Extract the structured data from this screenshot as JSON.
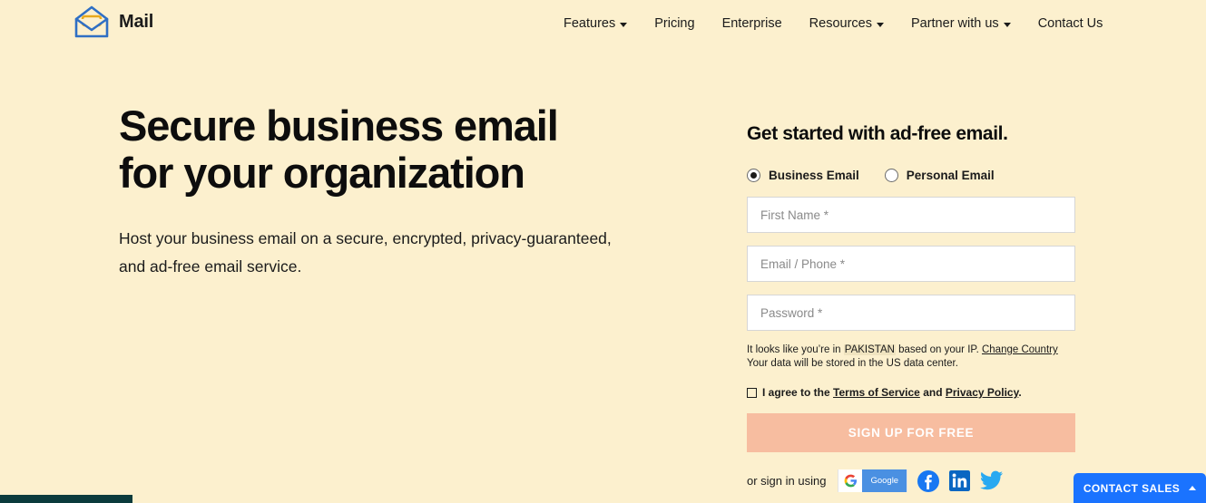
{
  "brand": {
    "name": "Mail",
    "logo_icon": "open-envelope-icon"
  },
  "nav": {
    "items": [
      {
        "label": "Features",
        "has_dropdown": true
      },
      {
        "label": "Pricing",
        "has_dropdown": false
      },
      {
        "label": "Enterprise",
        "has_dropdown": false
      },
      {
        "label": "Resources",
        "has_dropdown": true
      },
      {
        "label": "Partner with us",
        "has_dropdown": true
      },
      {
        "label": "Contact Us",
        "has_dropdown": false
      }
    ]
  },
  "hero": {
    "title_line1": "Secure business email",
    "title_line2": "for your organization",
    "subtitle": "Host your business email on a secure, encrypted, privacy-guaranteed, and ad-free email service."
  },
  "form": {
    "heading": "Get started with ad-free email.",
    "account_type": {
      "selected": "Business Email",
      "options": [
        {
          "label": "Business Email",
          "checked": true
        },
        {
          "label": "Personal Email",
          "checked": false
        }
      ]
    },
    "fields": [
      {
        "name": "first-name",
        "placeholder": "First Name *",
        "value": ""
      },
      {
        "name": "email-phone",
        "placeholder": "Email / Phone *",
        "value": ""
      },
      {
        "name": "password",
        "placeholder": "Password *",
        "value": ""
      }
    ],
    "ip_note": {
      "prefix": "It looks like you’re in ",
      "country": "PAKISTAN",
      "middle": " based on your IP. ",
      "change_link": "Change Country",
      "line2": "Your data will be stored in the US data center."
    },
    "terms": {
      "checked": false,
      "prefix": "I agree to the ",
      "tos_link": "Terms of Service",
      "conjunction": " and ",
      "privacy_link": "Privacy Policy",
      "suffix": "."
    },
    "submit_label": "SIGN UP FOR FREE",
    "social": {
      "prefix": "or sign in using",
      "google_label": "Google",
      "providers": [
        "google-icon",
        "facebook-icon",
        "linkedin-icon",
        "twitter-icon"
      ]
    }
  },
  "contact_sales": {
    "label": "CONTACT SALES",
    "icon": "chevron-up-icon"
  },
  "colors": {
    "background": "#fcf0ce",
    "accent_blue": "#1a73ff",
    "submit_disabled": "#f7bda0",
    "teal_bar": "#0b3b3c"
  }
}
